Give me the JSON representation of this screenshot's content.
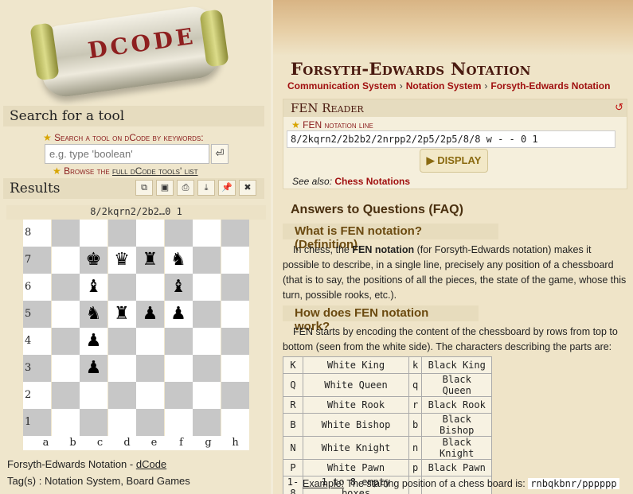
{
  "logo": {
    "text": "DCODE"
  },
  "search": {
    "title": "Search for a tool",
    "label": "Search a tool on dCode by keywords:",
    "placeholder": "e.g. type 'boolean'",
    "go_icon": "enter-icon",
    "browse_prefix": "Browse the ",
    "browse_link": "full dCode tools' list"
  },
  "results": {
    "title": "Results",
    "buttons": [
      "copy-icon",
      "screenshot-icon",
      "print-icon",
      "download-icon",
      "pin-icon",
      "close-icon"
    ],
    "fen_caption": "8/2kqrn2/2b2…0 1",
    "board": {
      "ranks": [
        "8",
        "7",
        "6",
        "5",
        "4",
        "3",
        "2",
        "1"
      ],
      "files": [
        "a",
        "b",
        "c",
        "d",
        "e",
        "f",
        "g",
        "h"
      ],
      "pieces": [
        {
          "sq": "c7",
          "glyph": "♚",
          "name": "black-king"
        },
        {
          "sq": "d7",
          "glyph": "♛",
          "name": "black-queen"
        },
        {
          "sq": "e7",
          "glyph": "♜",
          "name": "black-rook"
        },
        {
          "sq": "f7",
          "glyph": "♞",
          "name": "black-knight"
        },
        {
          "sq": "c6",
          "glyph": "♝",
          "name": "black-bishop"
        },
        {
          "sq": "f6",
          "glyph": "♝",
          "name": "black-bishop"
        },
        {
          "sq": "c5",
          "glyph": "♞",
          "name": "black-knight"
        },
        {
          "sq": "d5",
          "glyph": "♜",
          "name": "black-rook"
        },
        {
          "sq": "e5",
          "glyph": "♟",
          "name": "black-pawn"
        },
        {
          "sq": "f5",
          "glyph": "♟",
          "name": "black-pawn"
        },
        {
          "sq": "c4",
          "glyph": "♟",
          "name": "black-pawn"
        },
        {
          "sq": "c3",
          "glyph": "♟",
          "name": "black-pawn"
        }
      ]
    },
    "credit_text": "Forsyth-Edwards Notation - ",
    "credit_link": "dCode",
    "tags": "Tag(s) : Notation System, Board Games"
  },
  "page": {
    "title": "Forsyth-Edwards Notation",
    "breadcrumb": [
      "Communication System",
      "Notation System",
      "Forsyth-Edwards Notation"
    ],
    "breadcrumb_sep": "›"
  },
  "reader": {
    "title": "FEN Reader",
    "field_label_main": "FEN",
    "field_label_rest": "notation line",
    "field_value": "8/2kqrn2/2b2b2/2nrpp2/2p5/2p5/8/8 w - - 0 1",
    "display_label": "▶ DISPLAY",
    "see_also_prefix": "See also: ",
    "see_also_link": "Chess Notations"
  },
  "faq": {
    "title": "Answers to Questions (FAQ)",
    "q1": "What is FEN notation? (Definition)",
    "a1_pre": "In chess, the ",
    "a1_bold": "FEN notation",
    "a1_post": " (for Forsyth-Edwards notation) makes it possible to describe, in a single line, precisely any position of a chessboard (that is to say, the positions of all the pieces, the state of the game, whose this turn, possible rooks, etc.).",
    "q2": "How does FEN notation work?",
    "a2": "FEN starts by encoding the content of the chessboard by rows from top to bottom (seen from the white side). The characters describing the parts are:",
    "table": [
      [
        "K",
        "White King",
        "k",
        "Black King"
      ],
      [
        "Q",
        "White Queen",
        "q",
        "Black Queen"
      ],
      [
        "R",
        "White Rook",
        "r",
        "Black Rook"
      ],
      [
        "B",
        "White Bishop",
        "b",
        "Black Bishop"
      ],
      [
        "N",
        "White Knight",
        "n",
        "Black Knight"
      ],
      [
        "P",
        "White Pawn",
        "p",
        "Black Pawn"
      ],
      [
        "1-8",
        "1 to 8 empty boxes",
        "",
        ""
      ]
    ],
    "example_label": "Example:",
    "example_text": " The starting position of a chess board is: ",
    "example_code": "rnbqkbnr/pppppp"
  }
}
